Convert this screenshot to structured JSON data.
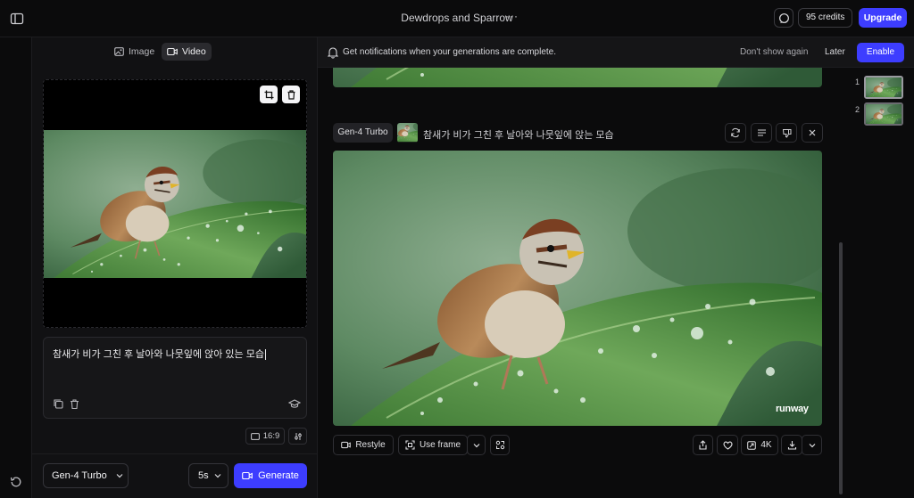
{
  "app": {
    "title": "Dewdrops and Sparrow",
    "title_menu": "···",
    "credits": "95 credits",
    "upgrade": "Upgrade"
  },
  "mode_tabs": [
    {
      "label": "Image",
      "icon": "image-icon",
      "active": false
    },
    {
      "label": "Video",
      "icon": "video-icon",
      "active": true
    }
  ],
  "prompt": {
    "text": "참새가 비가 그친 후 날아와 나뭇잎에 앉아 있는 모습"
  },
  "aspect_ratio": "16:9",
  "controls": {
    "model": "Gen-4 Turbo",
    "duration": "5s",
    "generate": "Generate"
  },
  "notification": {
    "text": "Get notifications when your generations are complete.",
    "dismiss": "Don't show again",
    "later": "Later",
    "enable": "Enable"
  },
  "generation": {
    "model_chip": "Gen-4 Turbo",
    "prompt": "참새가 비가 그친 후 날아와 나뭇잎에 앉는 모습",
    "watermark": "runway",
    "actions": {
      "restyle": "Restyle",
      "use_frame": "Use frame",
      "upscale": "4K"
    }
  },
  "thumbnails": [
    {
      "index": "1",
      "selected": true
    },
    {
      "index": "2",
      "selected": false
    }
  ],
  "colors": {
    "accent": "#3d3dff",
    "background": "#0b0b0c",
    "panel": "#111113"
  }
}
